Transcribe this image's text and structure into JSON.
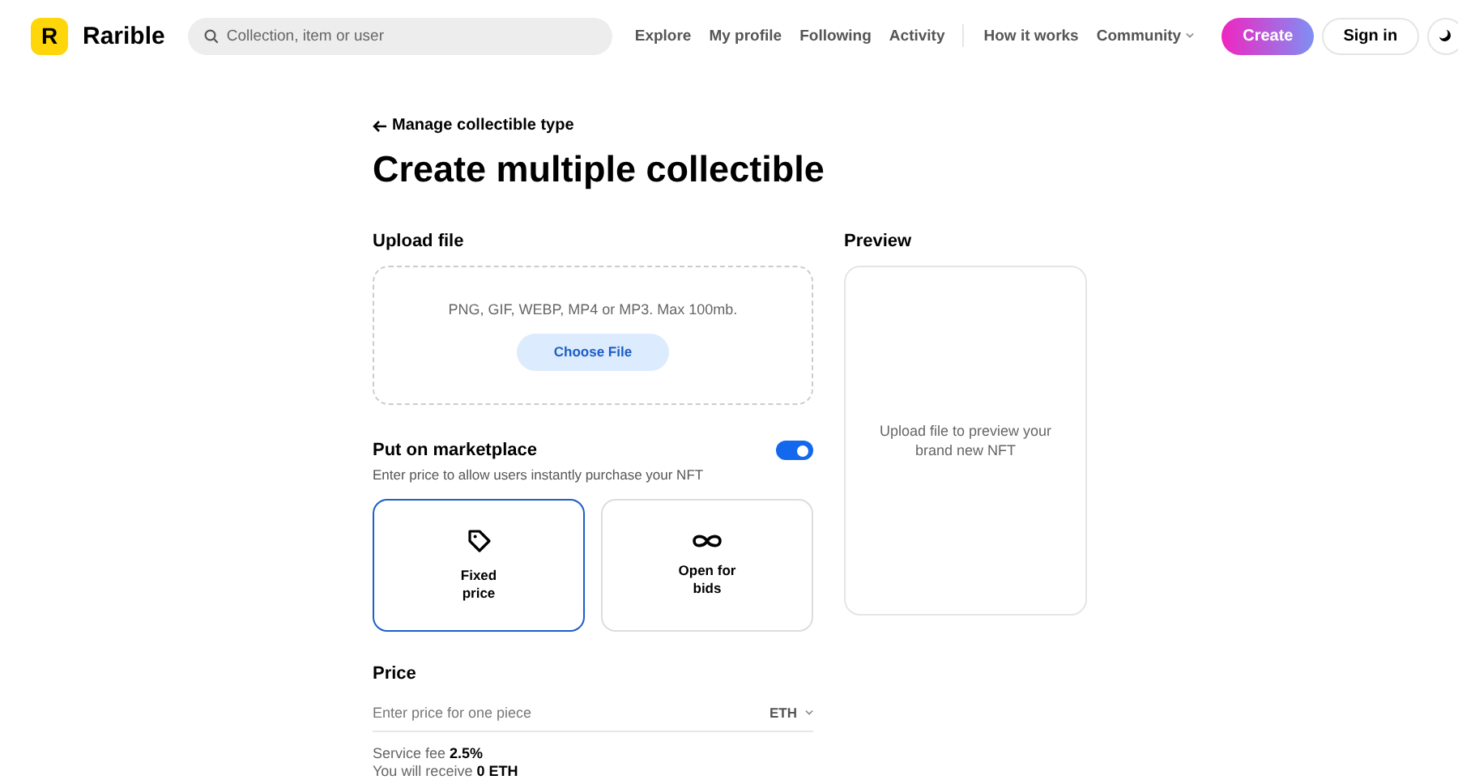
{
  "header": {
    "logo_mark": "R",
    "brand": "Rarible",
    "search": {
      "placeholder": "Collection, item or user"
    },
    "nav": [
      {
        "label": "Explore",
        "dropdown": false
      },
      {
        "label": "My profile",
        "dropdown": false
      },
      {
        "label": "Following",
        "dropdown": false
      },
      {
        "label": "Activity",
        "dropdown": false
      },
      {
        "label": "How it works",
        "dropdown": false
      },
      {
        "label": "Community",
        "dropdown": true
      }
    ],
    "create_button": "Create",
    "sign_in_button": "Sign in"
  },
  "back_link": "Manage collectible type",
  "title": "Create multiple collectible",
  "upload": {
    "label": "Upload file",
    "hint": "PNG, GIF, WEBP, MP4 or MP3. Max 100mb.",
    "button": "Choose File"
  },
  "marketplace": {
    "label": "Put on marketplace",
    "description": "Enter price to allow users instantly purchase your NFT",
    "on": true,
    "options": [
      {
        "kind": "tag",
        "label": "Fixed price",
        "selected": true
      },
      {
        "kind": "infinity",
        "label": "Open for bids",
        "selected": false
      }
    ]
  },
  "price": {
    "label": "Price",
    "placeholder": "Enter price for one piece",
    "currency": "ETH"
  },
  "fees": [
    "Service fee **2.5%**",
    "You will receive **0 ETH**"
  ],
  "preview": {
    "label": "Preview",
    "message": "Upload file to preview your brand new NFT"
  }
}
